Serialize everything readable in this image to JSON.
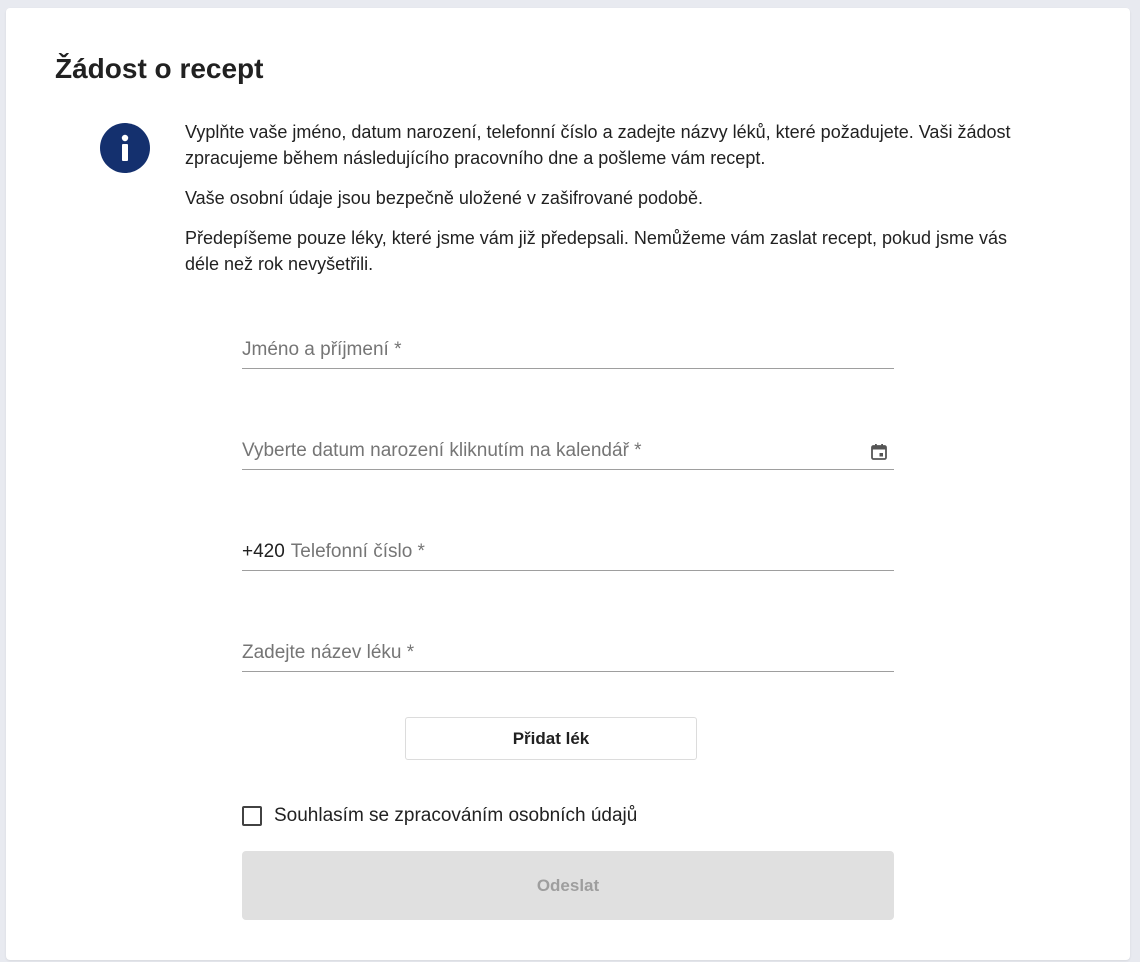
{
  "form": {
    "title": "Žádost o recept",
    "info": {
      "icon": "info-icon",
      "paragraphs": [
        "Vyplňte vaše jméno, datum narození, telefonní číslo a zadejte názvy léků, které požadujete. Vaši žádost zpracujeme během následujícího pracovního dne a pošleme vám recept.",
        "Vaše osobní údaje jsou bezpečně uložené v zašifrované podobě.",
        "Předepíšeme pouze léky, které jsme vám již předepsali. Nemůžeme vám zaslat recept, pokud jsme vás déle než rok nevyšetřili."
      ]
    },
    "fields": {
      "name": {
        "label": "Jméno a příjmení *",
        "value": ""
      },
      "birthdate": {
        "label": "Vyberte datum narození kliknutím na kalendář *",
        "icon": "calendar-icon",
        "value": ""
      },
      "phone": {
        "prefix": "+420",
        "label": "Telefonní číslo *",
        "value": ""
      },
      "medicine": {
        "label": "Zadejte název léku *",
        "value": ""
      }
    },
    "add_button": "Přidat lék",
    "consent": {
      "label": "Souhlasím se zpracováním osobních údajů",
      "checked": false
    },
    "submit_button": "Odeslat"
  },
  "colors": {
    "accent": "#14306e",
    "submit_disabled_bg": "#e0e0e0",
    "submit_disabled_text": "#9e9e9e"
  }
}
